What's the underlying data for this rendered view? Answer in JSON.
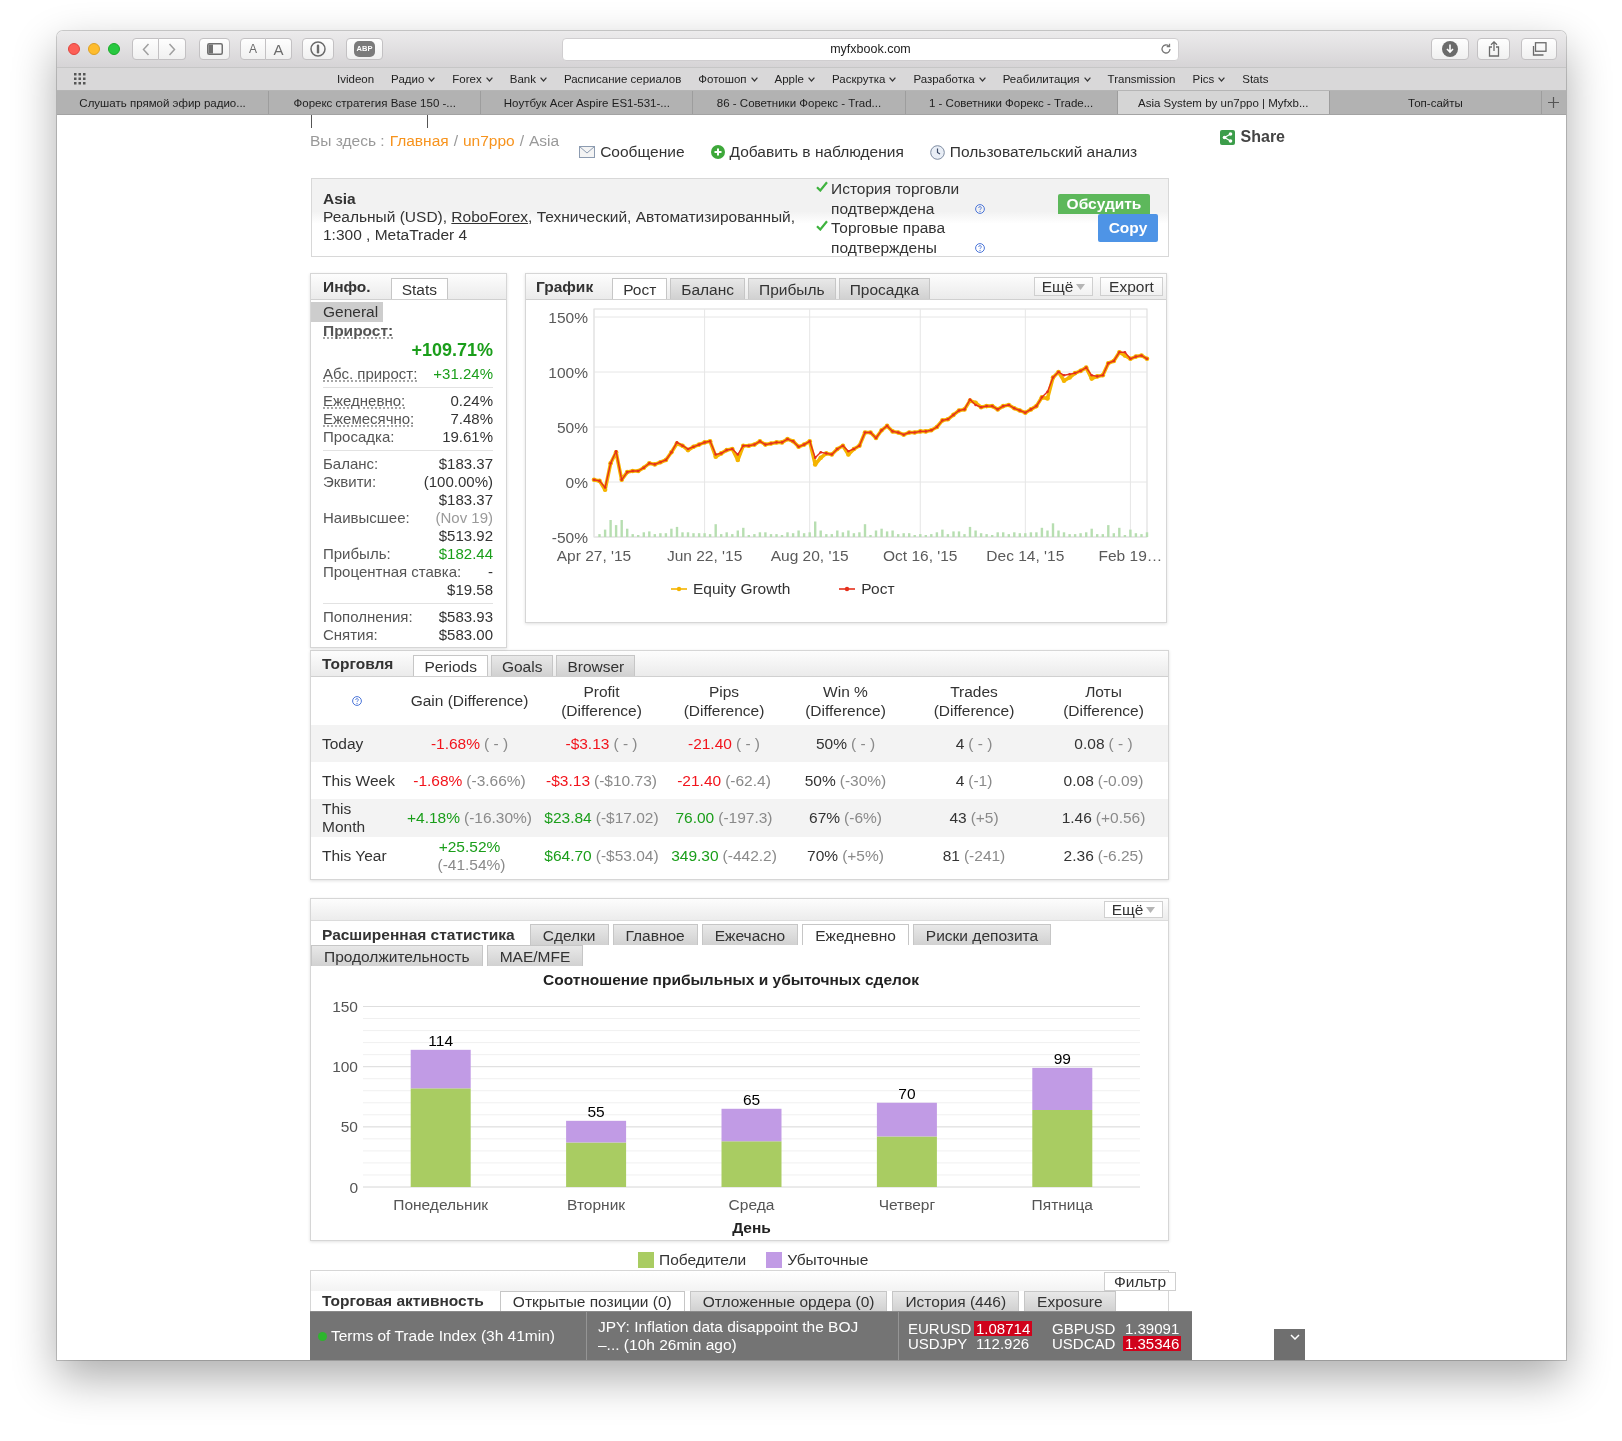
{
  "browser": {
    "text_size_buttons": [
      "A",
      "A"
    ],
    "adblock_label": "ABP",
    "address": "myfxbook.com",
    "bookmarks": [
      {
        "label": "Ivideon",
        "folder": false
      },
      {
        "label": "Радио",
        "folder": true
      },
      {
        "label": "Forex",
        "folder": true
      },
      {
        "label": "Bank",
        "folder": true
      },
      {
        "label": "Расписание сериалов",
        "folder": false
      },
      {
        "label": "Фотошоп",
        "folder": true
      },
      {
        "label": "Apple",
        "folder": true
      },
      {
        "label": "Раскрутка",
        "folder": true
      },
      {
        "label": "Разработка",
        "folder": true
      },
      {
        "label": "Реабилитация",
        "folder": true
      },
      {
        "label": "Transmission",
        "folder": false
      },
      {
        "label": "Pics",
        "folder": true
      },
      {
        "label": "Stats",
        "folder": false
      }
    ],
    "tabs": [
      {
        "title": "Слушать прямой эфир радио...",
        "selected": false
      },
      {
        "title": "Форекс стратегия Base 150 -...",
        "selected": false
      },
      {
        "title": "Ноутбук Acer Aspire ES1-531-...",
        "selected": false
      },
      {
        "title": "86 - Советники Форекс - Trad...",
        "selected": false
      },
      {
        "title": "1 - Советники Форекс - Trade...",
        "selected": false
      },
      {
        "title": "Asia System by un7ppo | Myfxb...",
        "selected": true
      },
      {
        "title": "Топ-сайты",
        "selected": false
      }
    ]
  },
  "breadcrumb": {
    "prefix": "Вы здесь :",
    "items": [
      {
        "label": "Главная",
        "link": true
      },
      {
        "label": "un7ppo",
        "link": true
      },
      {
        "label": "Asia",
        "link": false
      }
    ],
    "separators": [
      "/",
      "/"
    ]
  },
  "actions": [
    "Сообщение",
    "Добавить в наблюдения",
    "Пользовательский анализ"
  ],
  "share": "Share",
  "account": {
    "name": "Asia",
    "description_start": "Реальный (USD), ",
    "broker": "RoboForex",
    "description_end": ", Технический, Автоматизированный, 1:300 , MetaTrader 4",
    "verifications": [
      {
        "text": "История торговли подтверждена",
        "verified": true
      },
      {
        "text": "Торговые права подтверждены",
        "verified": true
      }
    ],
    "discuss_button": "Обсудить",
    "copy_button": "Copy"
  },
  "info_panel": {
    "title": "Инфо.",
    "tabs": [
      {
        "label": "Stats",
        "selected": true
      }
    ],
    "sections": [
      {
        "label": "General",
        "selected": true
      }
    ],
    "headline": {
      "label": "Прирост:",
      "dotted": true,
      "value": "+109.71%",
      "color": "#1a9e1a"
    },
    "groups": [
      [
        {
          "label": "Абс. прирост:",
          "dotted": true,
          "values": [
            {
              "text": "+31.24%",
              "color": "#1a9e1a"
            }
          ]
        }
      ],
      [
        {
          "label": "Ежедневно:",
          "dotted": true,
          "values": [
            {
              "text": "0.24%"
            }
          ]
        },
        {
          "label": "Ежемесячно:",
          "dotted": true,
          "values": [
            {
              "text": "7.48%"
            }
          ]
        },
        {
          "label": "Просадка:",
          "dotted": false,
          "values": [
            {
              "text": "19.61%"
            }
          ]
        }
      ],
      [
        {
          "label": "Баланс:",
          "dotted": false,
          "values": [
            {
              "text": "$183.37"
            }
          ]
        },
        {
          "label": "Эквити:",
          "dotted": false,
          "values": [
            {
              "text": "(100.00%)"
            },
            {
              "text": "$183.37"
            }
          ]
        },
        {
          "label": "Наивысшее:",
          "dotted": false,
          "values": [
            {
              "text": "(Nov 19)",
              "color": "#9a9a9a"
            },
            {
              "text": "$513.92"
            }
          ]
        },
        {
          "label": "Прибыль:",
          "dotted": false,
          "values": [
            {
              "text": "$182.44",
              "color": "#1a9e1a"
            }
          ]
        },
        {
          "label": "Процентная ставка:",
          "dotted": false,
          "values": [
            {
              "text": "-"
            },
            {
              "text": "$19.58"
            }
          ]
        }
      ],
      [
        {
          "label": "Пополнения:",
          "dotted": false,
          "values": [
            {
              "text": "$583.93"
            }
          ]
        },
        {
          "label": "Снятия:",
          "dotted": false,
          "values": [
            {
              "text": "$583.00"
            }
          ]
        }
      ]
    ]
  },
  "chart_panel": {
    "title": "График",
    "tabs": [
      {
        "label": "Рост",
        "selected": true
      },
      {
        "label": "Баланс",
        "selected": false
      },
      {
        "label": "Прибыль",
        "selected": false
      },
      {
        "label": "Просадка",
        "selected": false
      }
    ],
    "more_button": "Ещё",
    "export_button": "Export",
    "chart_data": {
      "type": "line",
      "legend": "bottom",
      "grid": true,
      "categories": [
        "Apr 27, '15",
        null,
        null,
        null,
        null,
        null,
        null,
        null,
        null,
        null,
        null,
        null,
        null,
        null,
        null,
        null,
        null,
        null,
        null,
        null,
        "Jun 22, '15",
        null,
        null,
        null,
        null,
        null,
        null,
        null,
        null,
        null,
        null,
        null,
        null,
        null,
        null,
        null,
        null,
        null,
        null,
        "Aug 20, '15",
        null,
        null,
        null,
        null,
        null,
        null,
        null,
        null,
        null,
        null,
        null,
        null,
        null,
        null,
        null,
        null,
        null,
        null,
        null,
        "Oct 16, '15",
        null,
        null,
        null,
        null,
        null,
        null,
        null,
        null,
        null,
        null,
        null,
        null,
        null,
        null,
        null,
        null,
        null,
        null,
        "Dec 14, '15",
        null,
        null,
        null,
        null,
        null,
        null,
        null,
        null,
        null,
        null,
        null,
        null,
        null,
        null,
        null,
        null,
        null,
        null,
        "Feb 19…",
        null,
        null,
        null
      ],
      "series": [
        {
          "name": "Equity Growth",
          "color": "#f5b400",
          "values": [
            2,
            1,
            -7,
            17,
            27,
            2,
            9,
            10,
            10,
            13,
            17,
            16,
            18,
            20,
            27,
            35,
            33,
            29,
            32,
            34,
            36,
            37,
            23,
            26,
            29,
            30,
            20,
            33,
            33,
            34,
            37,
            34,
            35,
            36,
            36,
            39,
            37,
            32,
            34,
            37,
            16,
            22,
            26,
            25,
            30,
            33,
            25,
            30,
            33,
            45,
            45,
            40,
            47,
            51,
            46,
            45,
            43,
            45,
            45,
            46,
            46,
            47,
            50,
            56,
            57,
            61,
            65,
            66,
            74,
            72,
            68,
            69,
            69,
            66,
            69,
            70,
            67,
            65,
            63,
            66,
            69,
            77,
            76,
            95,
            100,
            92,
            95,
            99,
            101,
            104,
            94,
            96,
            97,
            108,
            110,
            118,
            115,
            112,
            114,
            115,
            112
          ]
        },
        {
          "name": "Рост",
          "color": "#e5301c",
          "values": [
            2,
            1,
            -5,
            17,
            28,
            2,
            9,
            10,
            10,
            13,
            17,
            16,
            18,
            20,
            27,
            36,
            33,
            30,
            32,
            34,
            36,
            37,
            25,
            26,
            29,
            30,
            25,
            33,
            33,
            34,
            37,
            34,
            35,
            36,
            36,
            39,
            37,
            32,
            34,
            37,
            22,
            27,
            26,
            25,
            30,
            33,
            28,
            30,
            33,
            45,
            45,
            40,
            47,
            51,
            46,
            45,
            43,
            45,
            45,
            46,
            46,
            47,
            50,
            56,
            57,
            61,
            65,
            66,
            75,
            70,
            68,
            69,
            69,
            66,
            69,
            70,
            67,
            65,
            63,
            66,
            69,
            77,
            82,
            95,
            100,
            97,
            98,
            99,
            101,
            104,
            97,
            96,
            97,
            108,
            110,
            118,
            118,
            112,
            114,
            115,
            112
          ]
        }
      ],
      "ylim": [
        -50,
        150
      ],
      "yticks": [
        {
          "value": 150,
          "label": "150%"
        },
        {
          "value": 100,
          "label": "100%"
        },
        {
          "value": 50,
          "label": "50%"
        },
        {
          "value": 0,
          "label": "0%"
        },
        {
          "value": -50,
          "label": "-50%"
        }
      ]
    }
  },
  "trading_panel": {
    "title": "Торговля",
    "tabs": [
      {
        "label": "Periods",
        "selected": true
      },
      {
        "label": "Goals",
        "selected": false
      },
      {
        "label": "Browser",
        "selected": false
      }
    ],
    "columns": [
      "Gain (Difference)",
      "Profit (Difference)",
      "Pips (Difference)",
      "Win % (Difference)",
      "Trades (Difference)",
      "Лоты (Difference)"
    ],
    "rows": [
      {
        "period": "Today",
        "cells": [
          {
            "value": "-1.68%",
            "diff": "( - )",
            "color": "#f2141c"
          },
          {
            "value": "-$3.13",
            "diff": "( - )",
            "color": "#f2141c"
          },
          {
            "value": "-21.40",
            "diff": "( - )",
            "color": "#f2141c"
          },
          {
            "value": "50%",
            "diff": "( - )"
          },
          {
            "value": "4",
            "diff": "( - )"
          },
          {
            "value": "0.08",
            "diff": "( - )"
          }
        ]
      },
      {
        "period": "This Week",
        "cells": [
          {
            "value": "-1.68%",
            "diff": "(-3.66%)",
            "color": "#f2141c"
          },
          {
            "value": "-$3.13",
            "diff": "(-$10.73)",
            "color": "#f2141c"
          },
          {
            "value": "-21.40",
            "diff": "(-62.4)",
            "color": "#f2141c"
          },
          {
            "value": "50%",
            "diff": "(-30%)"
          },
          {
            "value": "4",
            "diff": "(-1)"
          },
          {
            "value": "0.08",
            "diff": "(-0.09)"
          }
        ]
      },
      {
        "period": "This Month",
        "cells": [
          {
            "value": "+4.18%",
            "diff": "(-16.30%)",
            "color": "#1a9e1a"
          },
          {
            "value": "$23.84",
            "diff": "(-$17.02)",
            "color": "#1a9e1a"
          },
          {
            "value": "76.00",
            "diff": "(-197.3)",
            "color": "#1a9e1a"
          },
          {
            "value": "67%",
            "diff": "(-6%)"
          },
          {
            "value": "43",
            "diff": "(+5)"
          },
          {
            "value": "1.46",
            "diff": "(+0.56)"
          }
        ]
      },
      {
        "period": "This Year",
        "cells": [
          {
            "value": "+25.52%",
            "diff": "(-41.54%)",
            "color": "#1a9e1a"
          },
          {
            "value": "$64.70",
            "diff": "(-$53.04)",
            "color": "#1a9e1a"
          },
          {
            "value": "349.30",
            "diff": "(-442.2)",
            "color": "#1a9e1a"
          },
          {
            "value": "70%",
            "diff": "(+5%)"
          },
          {
            "value": "81",
            "diff": "(-241)"
          },
          {
            "value": "2.36",
            "diff": "(-6.25)"
          }
        ]
      }
    ]
  },
  "extended_panel": {
    "more_button": "Ещё",
    "title": "Расширенная статистика",
    "tabs": [
      {
        "label": "Сделки",
        "selected": false
      },
      {
        "label": "Главное",
        "selected": false
      },
      {
        "label": "Ежечасно",
        "selected": false
      },
      {
        "label": "Ежедневно",
        "selected": true
      },
      {
        "label": "Риски депозита",
        "selected": false
      },
      {
        "label": "Продолжительность",
        "selected": false
      },
      {
        "label": "MAE/MFE",
        "selected": false
      }
    ],
    "chart_data": {
      "type": "bar",
      "legend": "bottom",
      "grid": true,
      "title": "Соотношение прибыльных и убыточных сделок",
      "xlabel": "День",
      "categories": [
        "Понедельник",
        "Вторник",
        "Среда",
        "Четверг",
        "Пятница"
      ],
      "series": [
        {
          "name": "Победители",
          "color": "#a9cc62",
          "values": [
            82,
            37,
            38,
            42,
            64
          ]
        },
        {
          "name": "Убыточные",
          "color": "#c19be5",
          "values": [
            32,
            18,
            27,
            28,
            35
          ]
        }
      ],
      "stacked": true,
      "ylim": [
        0,
        150
      ],
      "yticks": [
        0,
        50,
        100,
        150
      ],
      "value_labels": [
        "114",
        "55",
        "65",
        "70",
        "99"
      ]
    }
  },
  "activity_panel": {
    "filter_button": "Фильтр",
    "title": "Торговая активность",
    "tabs": [
      {
        "label": "Открытые позиции (0)",
        "selected": true
      },
      {
        "label": "Отложенные ордера (0)",
        "selected": false
      },
      {
        "label": "История (446)",
        "selected": false
      },
      {
        "label": "Exposure",
        "selected": false
      }
    ]
  },
  "ticker": {
    "alert": {
      "text": "Terms of Trade Index (3h 41min)",
      "color": "#2db52d"
    },
    "news": "JPY: Inflation data disappoint the BOJ –... (10h 26min ago)",
    "quotes": [
      {
        "symbol": "EURUSD",
        "price": "1.08714",
        "highlighted": true
      },
      {
        "symbol": "GBPUSD",
        "price": "1.39091",
        "highlighted": false
      },
      {
        "symbol": "USDJPY",
        "price": "112.926",
        "highlighted": false
      },
      {
        "symbol": "USDCAD",
        "price": "1.35346",
        "highlighted": true
      }
    ]
  }
}
